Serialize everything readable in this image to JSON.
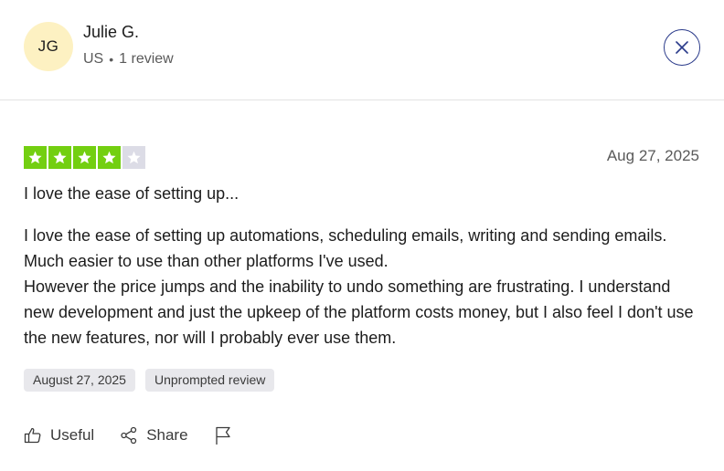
{
  "reviewer": {
    "initials": "JG",
    "name": "Julie G.",
    "country": "US",
    "review_count": "1 review"
  },
  "colors": {
    "avatar_bg": "#fdf1c2",
    "star_filled": "#73cf11",
    "star_empty": "#dcdce6",
    "close_border": "#2a3a8a"
  },
  "review": {
    "rating": 4,
    "max_rating": 5,
    "date": "Aug 27, 2025",
    "title": "I love the ease of setting up...",
    "body_paragraph_1": "I love the ease of setting up automations, scheduling emails, writing and sending emails. Much easier to use than other platforms I've used.",
    "body_paragraph_2": "However the price jumps and the inability to undo something are frustrating. I understand new development and just the upkeep of the platform costs money, but I also feel I don't use the new features, nor will I probably ever use them."
  },
  "tags": {
    "date_tag": "August 27, 2025",
    "type_tag": "Unprompted review"
  },
  "actions": {
    "useful_label": "Useful",
    "share_label": "Share",
    "useful_icon": "thumbs-up-icon",
    "share_icon": "share-icon",
    "report_icon": "flag-icon",
    "close_icon": "close-icon"
  }
}
